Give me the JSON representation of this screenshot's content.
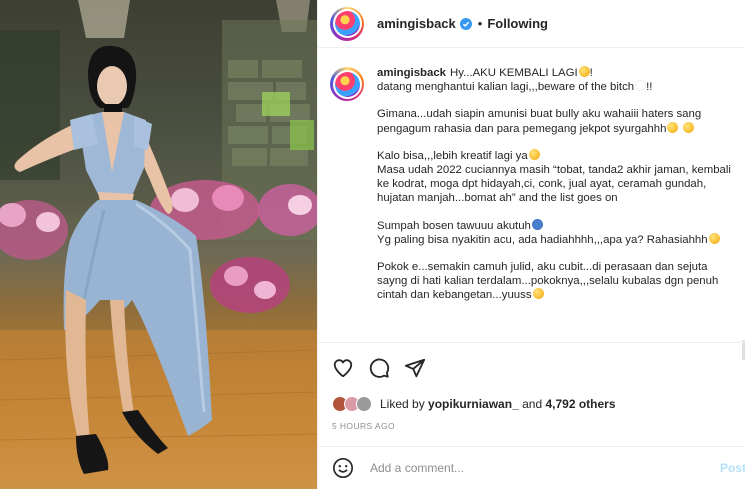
{
  "header": {
    "username": "amingisback",
    "separator": "•",
    "follow_status": "Following"
  },
  "caption": {
    "username": "amingisback",
    "lines": [
      "Hy...AKU KEMBALI LAGI",
      "datang menghantui kalian lagi,,,beware of the bitch",
      "",
      "Gimana...udah siapin amunisi buat bully aku wahaiii haters sang pengagum rahasia dan para pemegang jekpot syurgahhh",
      "",
      "Kalo bisa,,,lebih kreatif lagi ya",
      "Masa udah 2022 cuciannya masih “tobat, tanda2 akhir jaman, kembali ke kodrat, moga dpt hidayah,ci, conk, jual ayat, ceramah gundah, hujatan manjah...bomat ah” and the list goes on",
      "",
      "Sumpah bosen tawuuu akutuh",
      "Yg paling bisa nyakitin acu, ada hadiahhhh,,,apa ya? Rahasiahhh",
      "",
      "Pokok e...semakin camuh julid, aku cubit...di perasaan dan sejuta sayng di hati kalian terdalam...pokoknya,,,selalu kubalas dgn penuh cintah dan kebangetan...yuuss"
    ],
    "line_emoji": [
      "face",
      "ghost",
      "",
      "face-pray",
      "",
      "face",
      "",
      "",
      "person",
      "face",
      "",
      "face"
    ]
  },
  "actions": {
    "icons": [
      "heart-icon",
      "comment-icon",
      "share-icon"
    ]
  },
  "likes": {
    "prefix": "Liked by",
    "user": "yopikurniawan_",
    "connector": "and",
    "others": "4,792 others"
  },
  "timestamp": "5 HOURS AGO",
  "comment_box": {
    "placeholder": "Add a comment...",
    "post_label": "Post"
  },
  "colors": {
    "verified": "#3897f0",
    "dress": "#9fb8d6",
    "muted_text": "#8e8e8e",
    "post_button": "#b2dffc"
  }
}
